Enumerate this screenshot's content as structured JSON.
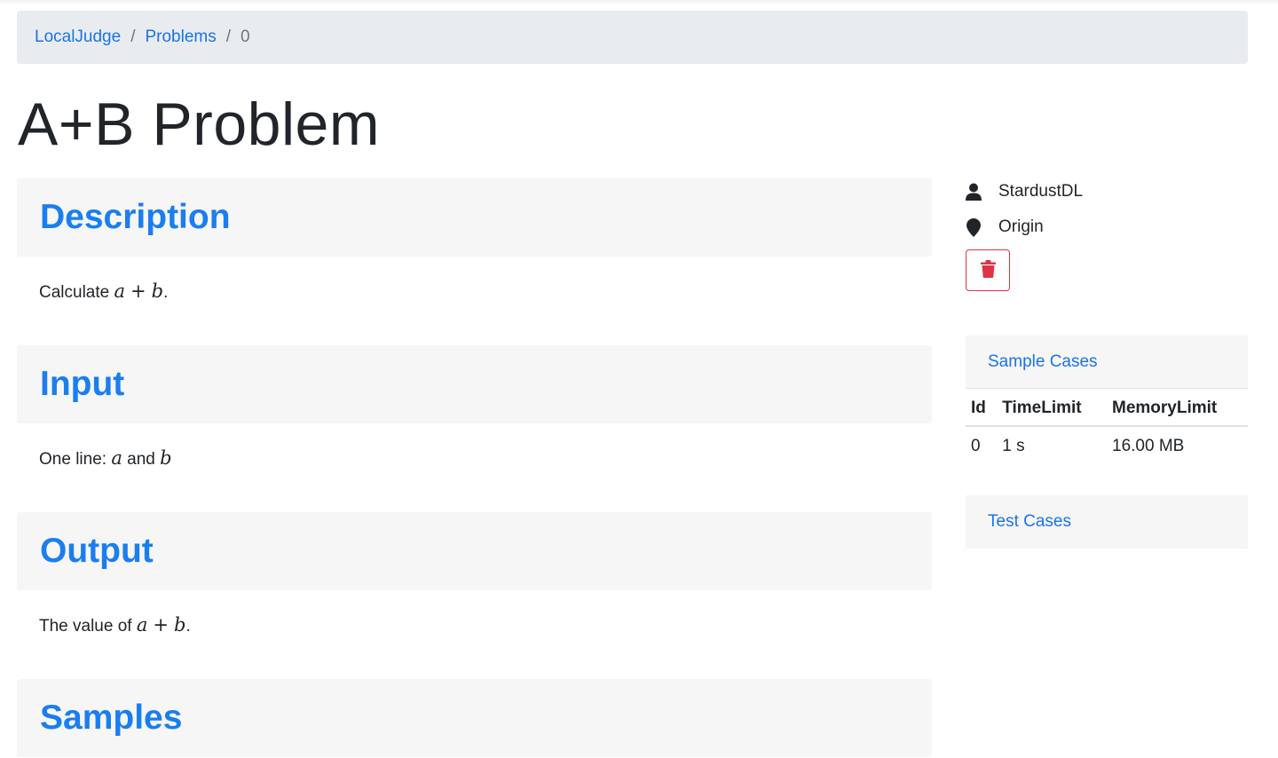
{
  "breadcrumb": {
    "home": "LocalJudge",
    "problems": "Problems",
    "current": "0",
    "separator": "/"
  },
  "title": "A+B Problem",
  "sections": {
    "description": {
      "heading": "Description",
      "text_prefix": "Calculate ",
      "math_a": "a",
      "math_op": "+",
      "math_b": "b",
      "text_suffix": "."
    },
    "input": {
      "heading": "Input",
      "text_prefix": "One line: ",
      "math_a": "a",
      "text_mid": " and ",
      "math_b": "b"
    },
    "output": {
      "heading": "Output",
      "text_prefix": "The value of ",
      "math_a": "a",
      "math_op": "+",
      "math_b": "b",
      "text_suffix": "."
    },
    "samples": {
      "heading": "Samples"
    }
  },
  "sidebar": {
    "author": "StardustDL",
    "source": "Origin",
    "author_icon": "user-icon",
    "source_icon": "map-marker-icon",
    "delete_icon": "trash-icon",
    "sample_cases": {
      "title": "Sample Cases",
      "columns": [
        "Id",
        "TimeLimit",
        "MemoryLimit"
      ],
      "rows": [
        [
          "0",
          "1 s",
          "16.00 MB"
        ]
      ]
    },
    "test_cases": {
      "title": "Test Cases"
    }
  },
  "colors": {
    "link": "#1a73e8",
    "heading": "#1a7ef0",
    "danger": "#dc3545",
    "panel": "#f6f6f6",
    "breadcrumb_bg": "#e9ecef"
  }
}
